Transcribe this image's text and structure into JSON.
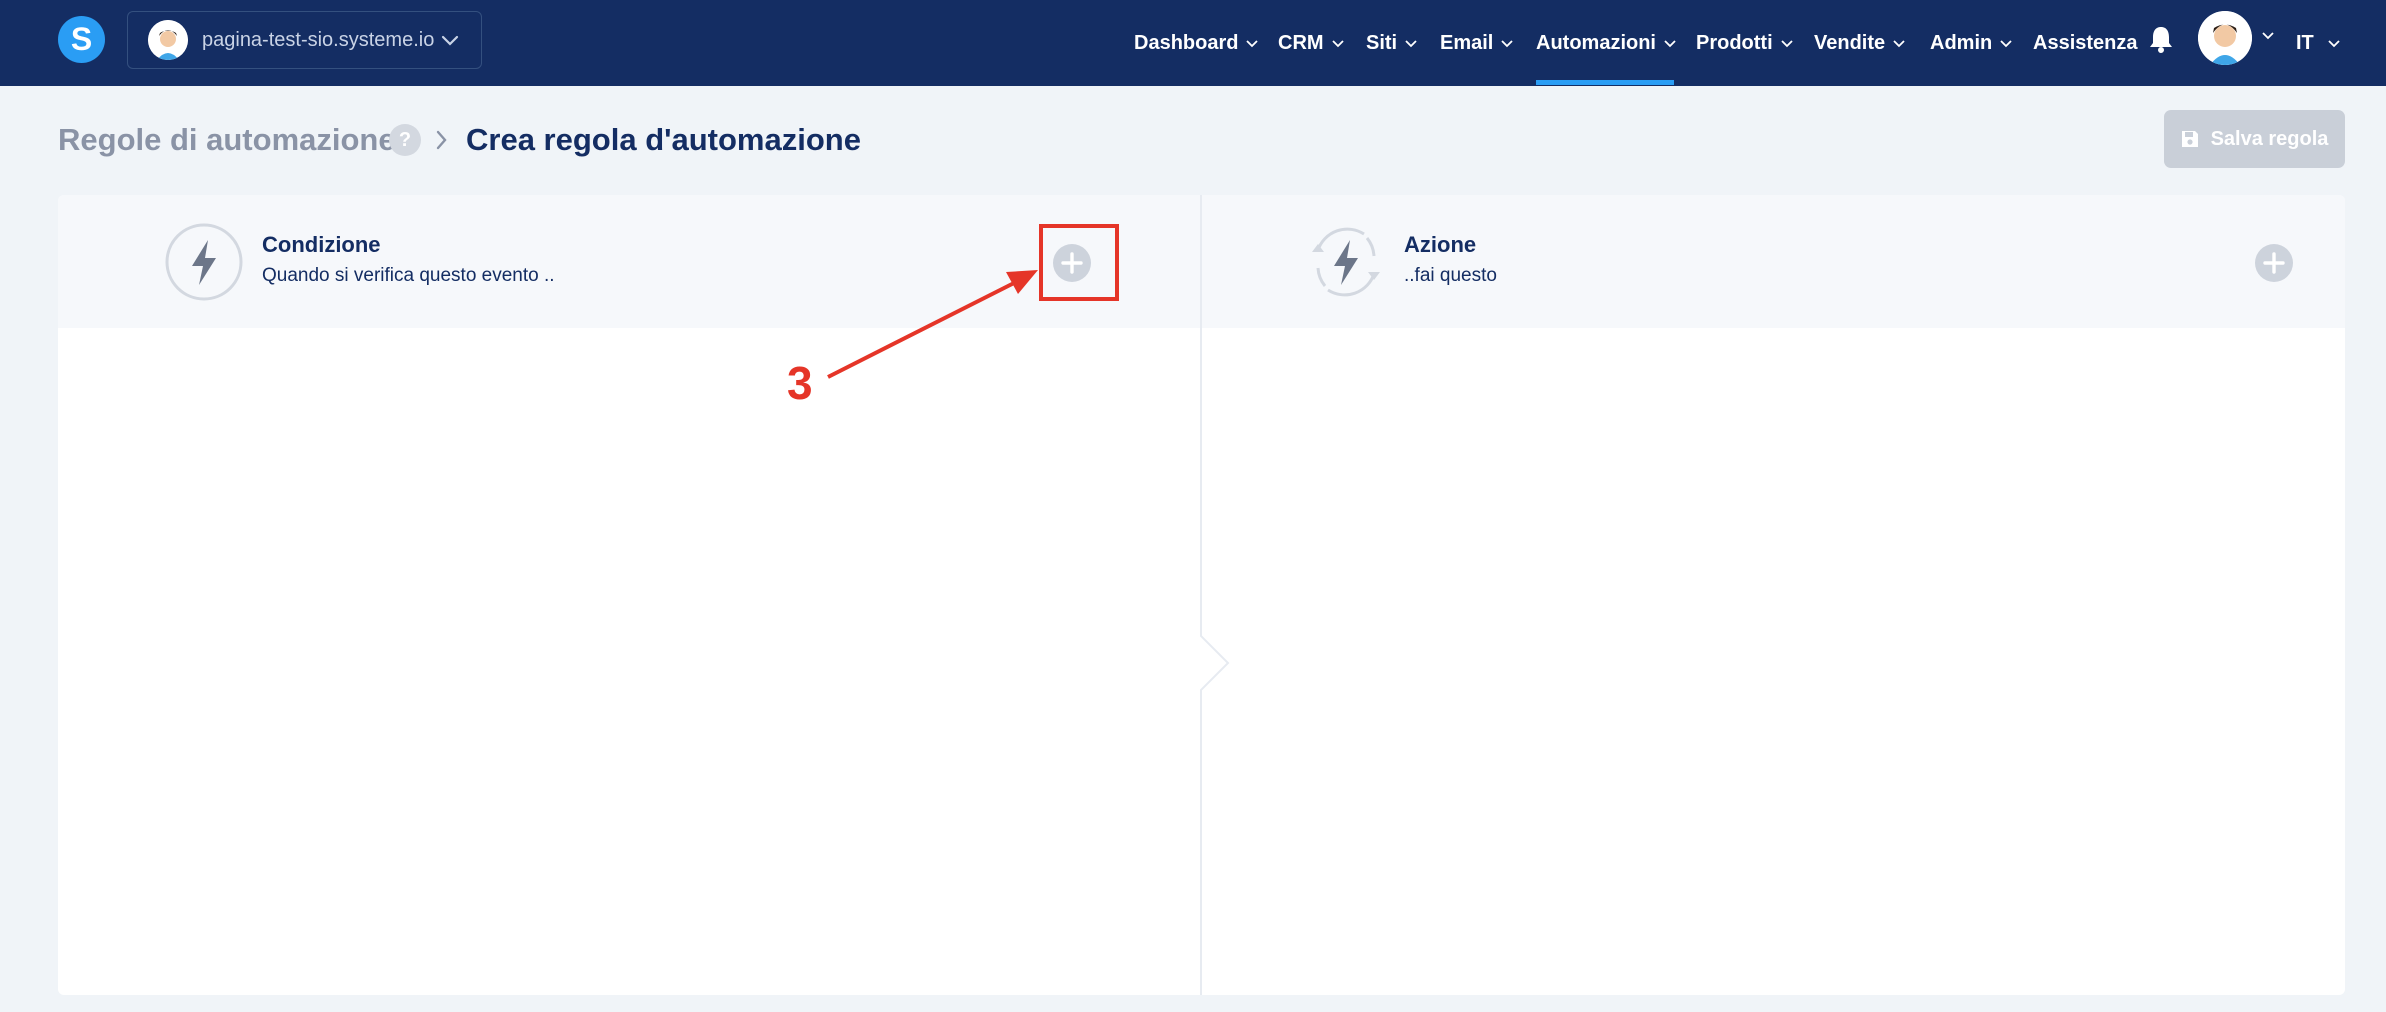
{
  "topbar": {
    "logo_letter": "S",
    "site_selector": {
      "label": "pagina-test-sio.systeme.io",
      "icon": "chevron-down-icon"
    },
    "nav": [
      {
        "label": "Dashboard",
        "has_menu": true
      },
      {
        "label": "CRM",
        "has_menu": true
      },
      {
        "label": "Siti",
        "has_menu": true
      },
      {
        "label": "Email",
        "has_menu": true
      },
      {
        "label": "Automazioni",
        "has_menu": true,
        "active": true
      },
      {
        "label": "Prodotti",
        "has_menu": true
      },
      {
        "label": "Vendite",
        "has_menu": true
      },
      {
        "label": "Admin",
        "has_menu": true
      },
      {
        "label": "Assistenza",
        "has_menu": false
      }
    ],
    "notifications_icon": "bell-icon",
    "language": "IT"
  },
  "header": {
    "breadcrumb_root": "Regole di automazione",
    "help_symbol": "?",
    "breadcrumb_current": "Crea regola d'automazione",
    "save_label": "Salva regola"
  },
  "panels": {
    "condition": {
      "title": "Condizione",
      "subtitle": "Quando si verifica questo evento ..",
      "icon": "bolt-icon"
    },
    "action": {
      "title": "Azione",
      "subtitle": "..fai questo",
      "icon": "bolt-cycle-icon"
    }
  },
  "annotation": {
    "step_number": "3"
  },
  "colors": {
    "navbar": "#142d63",
    "accent": "#2a9df4",
    "annotation": "#e53528",
    "page_background": "#f0f4f8"
  }
}
